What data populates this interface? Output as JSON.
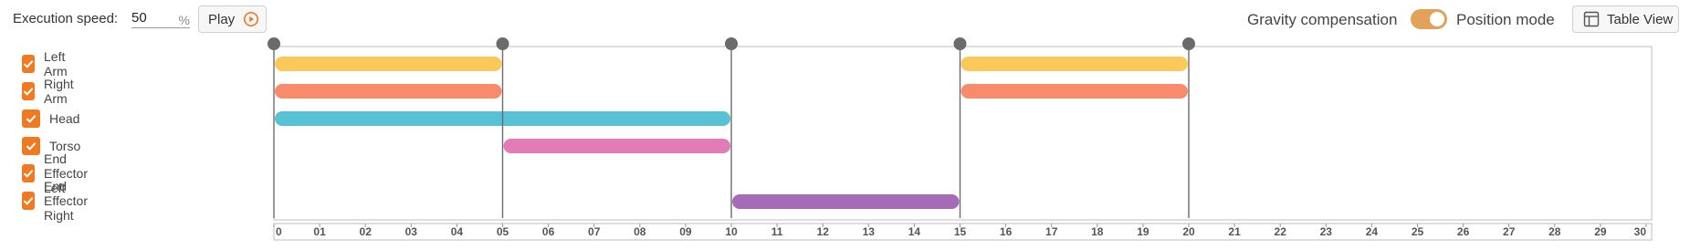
{
  "toolbar": {
    "speed_label": "Execution speed:",
    "speed_value": "50",
    "speed_unit": "%",
    "play_label": "Play",
    "gravity_label": "Gravity compensation",
    "gravity_on": true,
    "position_label": "Position mode",
    "table_view_label": "Table View",
    "accent_color": "#ef7a22"
  },
  "tracks": [
    {
      "label": "Left Arm",
      "checked": true,
      "color": "#fbc95a",
      "segments": [
        [
          0,
          5
        ],
        [
          15,
          20
        ]
      ]
    },
    {
      "label": "Right Arm",
      "checked": true,
      "color": "#f88b6b",
      "segments": [
        [
          0,
          5
        ],
        [
          15,
          20
        ]
      ]
    },
    {
      "label": "Head",
      "checked": true,
      "color": "#57c2d4",
      "segments": [
        [
          0,
          10
        ]
      ]
    },
    {
      "label": "Torso",
      "checked": true,
      "color": "#e27bb6",
      "segments": [
        [
          5,
          10
        ]
      ]
    },
    {
      "label": "End Effector Left",
      "checked": true,
      "color": "#a56ab8",
      "segments": []
    },
    {
      "label": "End Effector Right",
      "checked": true,
      "color": "#a56ab8",
      "segments": [
        [
          10,
          15
        ]
      ]
    }
  ],
  "timeline": {
    "keyframes": [
      0,
      5,
      10,
      15,
      20
    ],
    "tick_labels": [
      "0",
      "01",
      "02",
      "03",
      "04",
      "05",
      "06",
      "07",
      "08",
      "09",
      "10",
      "11",
      "12",
      "13",
      "14",
      "15",
      "16",
      "17",
      "18",
      "19",
      "20",
      "21",
      "22",
      "23",
      "24",
      "25",
      "26",
      "27",
      "28",
      "29",
      "30"
    ],
    "max": 30
  }
}
